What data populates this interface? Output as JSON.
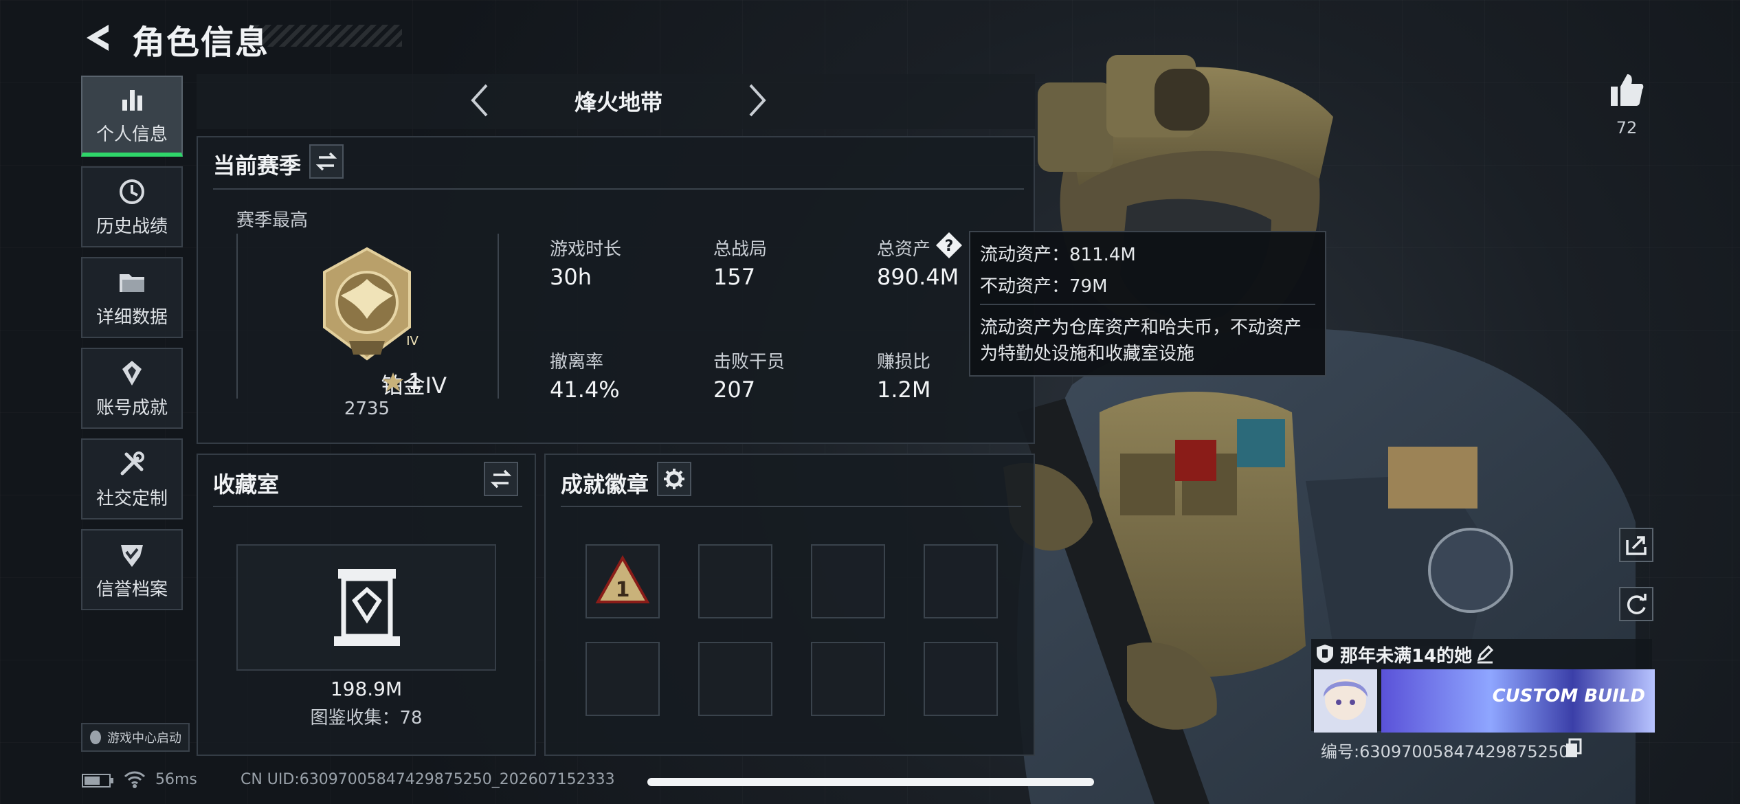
{
  "header": {
    "title": "角色信息"
  },
  "sidebar": {
    "items": [
      {
        "label": "个人信息",
        "icon": "bar-chart-icon",
        "active": true
      },
      {
        "label": "历史战绩",
        "icon": "clock-icon"
      },
      {
        "label": "详细数据",
        "icon": "folder-icon"
      },
      {
        "label": "账号成就",
        "icon": "trophy-icon"
      },
      {
        "label": "社交定制",
        "icon": "tools-icon"
      },
      {
        "label": "信誉档案",
        "icon": "shield-check-icon"
      }
    ],
    "game_center": "游戏中心启动"
  },
  "mode": {
    "title": "烽火地带"
  },
  "season": {
    "title": "当前赛季",
    "best_label": "赛季最高",
    "rank_name": "铂金IV",
    "rank_stars": "1",
    "rank_score": "2735",
    "rank_numeral": "IV",
    "stats": [
      {
        "label": "游戏时长",
        "value": "30h"
      },
      {
        "label": "总战局",
        "value": "157"
      },
      {
        "label": "总资产",
        "value": "890.4M"
      },
      {
        "label": "撤离率",
        "value": "41.4%"
      },
      {
        "label": "击败干员",
        "value": "207"
      },
      {
        "label": "赚损比",
        "value": "1.2M"
      }
    ]
  },
  "tooltip": {
    "liquid": "流动资产：811.4M",
    "fixed": "不动资产：79M",
    "desc_1": "流动资产为仓库资产和哈夫币，不动资产",
    "desc_2": "为特勤处设施和收藏室设施"
  },
  "collection": {
    "title": "收藏室",
    "value": "198.9M",
    "count": "图鉴收集：78"
  },
  "achievements": {
    "title": "成就徽章",
    "badge_numeral": "1"
  },
  "likes": {
    "count": "72"
  },
  "player": {
    "name": "那年未满14的她",
    "id": "编号:63097005847429875250",
    "banner_text": "CUSTOM BUILD"
  },
  "status": {
    "ping": "56ms",
    "uid": "CN UID:63097005847429875250_202607152333"
  },
  "colors": {
    "accent": "#2fd66a",
    "panel": "#161b21"
  }
}
